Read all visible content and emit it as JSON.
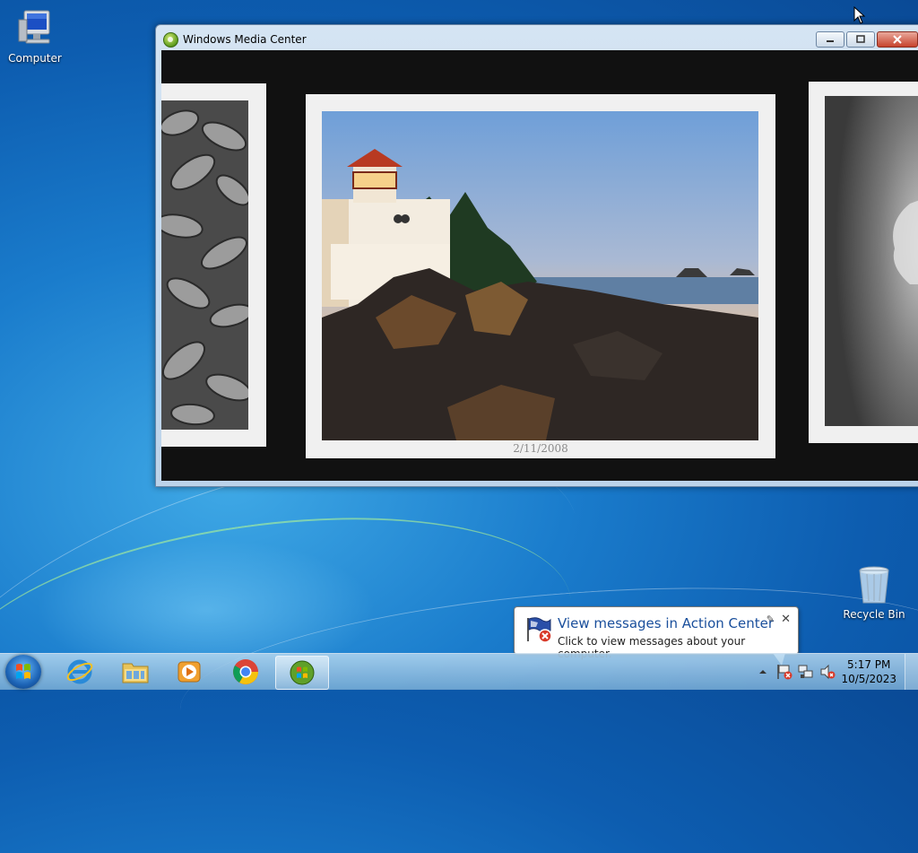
{
  "desktop": {
    "icons": [
      {
        "label": "Computer"
      },
      {
        "label": "Recycle Bin"
      }
    ]
  },
  "window": {
    "title": "Windows Media Center",
    "photo_date": "2/11/2008"
  },
  "notification": {
    "title": "View messages in Action Center",
    "text": "Click to view messages about your computer."
  },
  "taskbar": {
    "pinned": [
      "Internet Explorer",
      "Windows Explorer",
      "Windows Media Player",
      "Google Chrome",
      "Windows Media Center"
    ],
    "active": "Windows Media Center",
    "time": "5:17 PM",
    "date": "10/5/2023"
  },
  "colors": {
    "window_frame": "#bcd3ea",
    "media_background": "#111111",
    "balloon_title": "#1a4f9c"
  }
}
